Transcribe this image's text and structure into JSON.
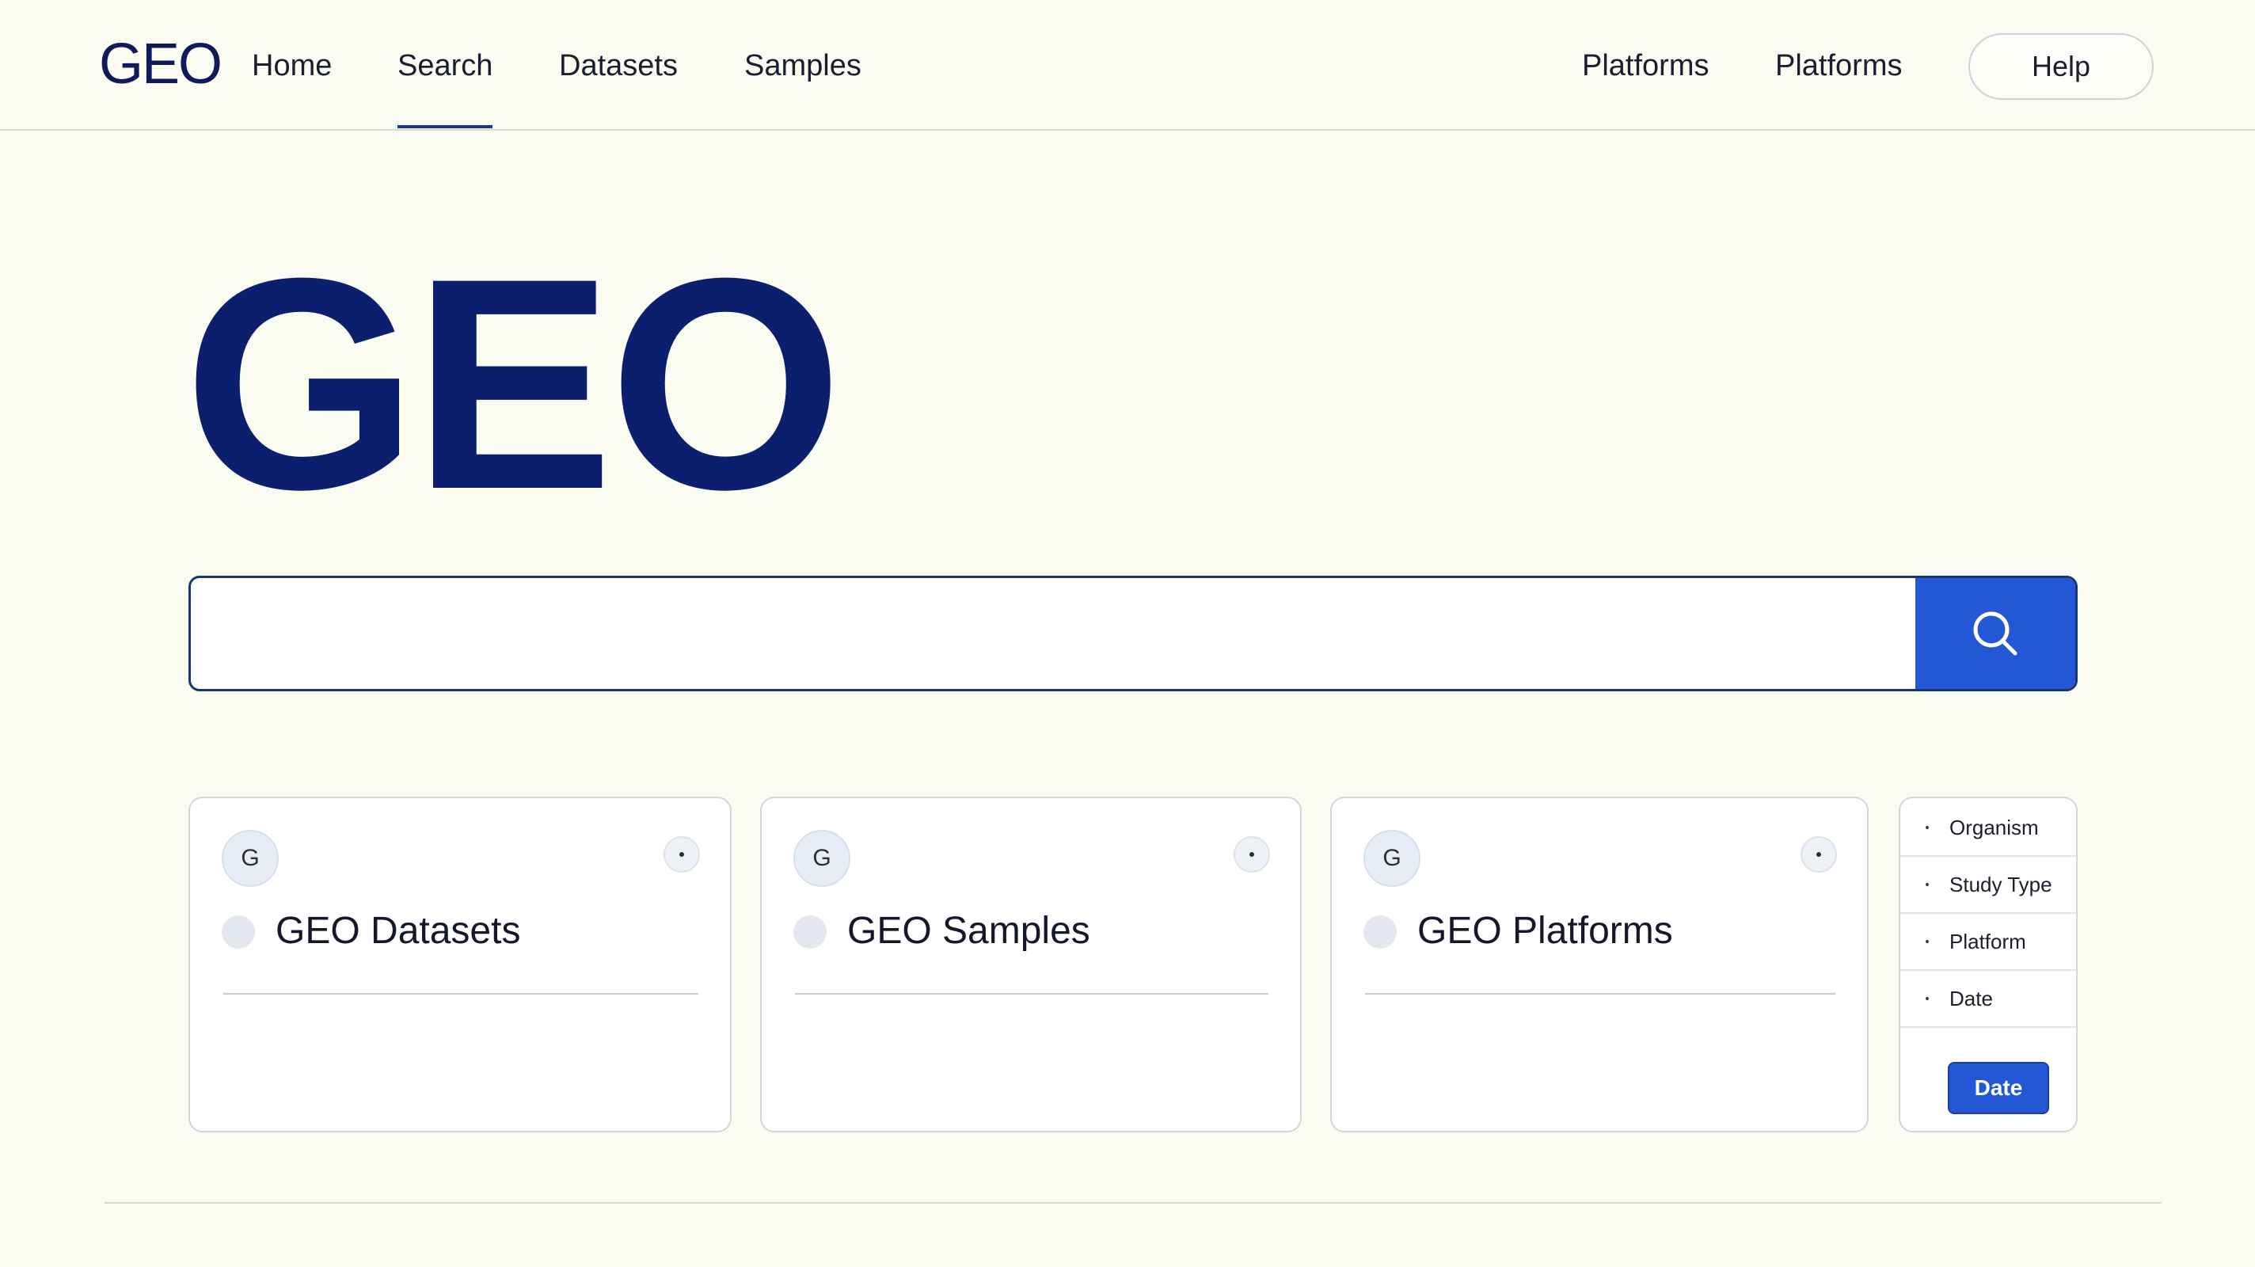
{
  "header": {
    "logo": "GEO",
    "nav_left": [
      {
        "label": "Home"
      },
      {
        "label": "Search",
        "active": true
      },
      {
        "label": "Datasets"
      },
      {
        "label": "Samples"
      }
    ],
    "nav_right": [
      {
        "label": "Platforms"
      },
      {
        "label": "Platforms"
      }
    ],
    "help_label": "Help"
  },
  "hero": {
    "title": "GEO"
  },
  "search": {
    "value": "",
    "icon": "search-icon"
  },
  "cards": [
    {
      "badge": "G",
      "title": "GEO Datasets"
    },
    {
      "badge": "G",
      "title": "GEO Samples"
    },
    {
      "badge": "G",
      "title": "GEO Platforms"
    }
  ],
  "filters": {
    "items": [
      "Organism",
      "Study Type",
      "Platform",
      "Date"
    ],
    "button_label": "Date"
  },
  "colors": {
    "background": "#fafbf1",
    "brand_navy": "#0c1f6e",
    "accent_blue": "#2357d6"
  }
}
